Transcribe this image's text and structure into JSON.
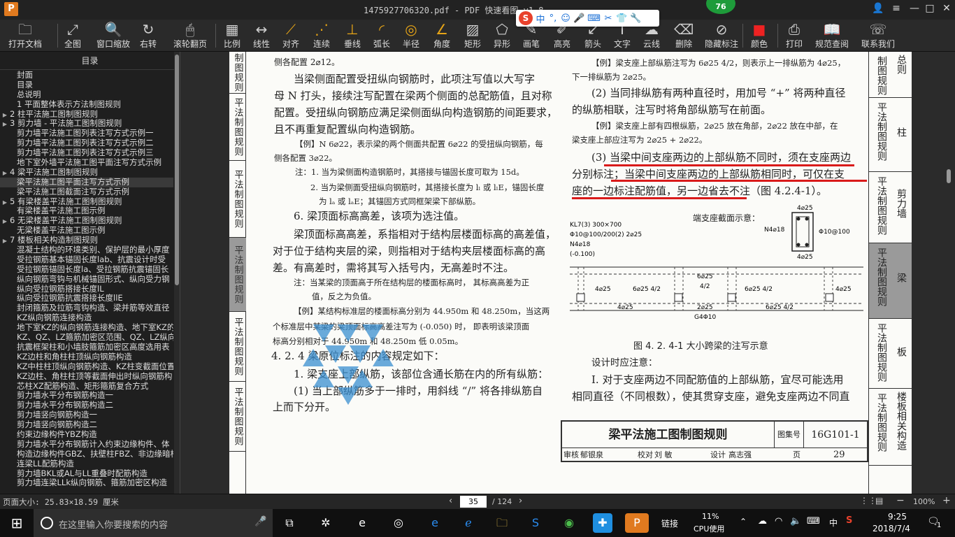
{
  "titlebar": {
    "title": "1475927706320.pdf - PDF 快速看图 v1.8",
    "app_icon": "P",
    "badge": "76"
  },
  "ime": {
    "logo": "S",
    "items": [
      "中",
      "°,",
      "☺",
      "🎤",
      "⌨",
      "✂",
      "👕",
      "🔧"
    ]
  },
  "toolbar": {
    "items": [
      {
        "label": "打开文档",
        "icon": "folder-icon",
        "glyph": "🗀"
      },
      {
        "label": "全图",
        "icon": "fullview-icon",
        "glyph": "⤢"
      },
      {
        "label": "窗口缩放",
        "icon": "zoom-window-icon",
        "glyph": "🔍"
      },
      {
        "label": "右转",
        "icon": "rotate-right-icon",
        "glyph": "↻"
      },
      {
        "label": "滚轮翻页",
        "icon": "mouse-wheel-icon",
        "glyph": "🖱"
      },
      {
        "label": "比例",
        "icon": "scale-icon",
        "glyph": "▦"
      },
      {
        "label": "线性",
        "icon": "linear-icon",
        "glyph": "↔"
      },
      {
        "label": "对齐",
        "icon": "align-icon",
        "glyph": "⟋"
      },
      {
        "label": "连续",
        "icon": "continuous-icon",
        "glyph": "⋰"
      },
      {
        "label": "垂线",
        "icon": "perpendicular-icon",
        "glyph": "⊥"
      },
      {
        "label": "弧长",
        "icon": "arc-length-icon",
        "glyph": "◜"
      },
      {
        "label": "半径",
        "icon": "radius-icon",
        "glyph": "◎"
      },
      {
        "label": "角度",
        "icon": "angle-icon",
        "glyph": "∠"
      },
      {
        "label": "矩形",
        "icon": "rectangle-icon",
        "glyph": "▨"
      },
      {
        "label": "异形",
        "icon": "irregular-icon",
        "glyph": "⬠"
      },
      {
        "label": "画笔",
        "icon": "brush-icon",
        "glyph": "✎"
      },
      {
        "label": "高亮",
        "icon": "highlight-icon",
        "glyph": "✐"
      },
      {
        "label": "箭头",
        "icon": "arrow-icon",
        "glyph": "↙"
      },
      {
        "label": "文字",
        "icon": "text-icon",
        "glyph": "T"
      },
      {
        "label": "云线",
        "icon": "cloud-icon",
        "glyph": "☁"
      },
      {
        "label": "删除",
        "icon": "eraser-icon",
        "glyph": "⌫"
      },
      {
        "label": "隐藏标注",
        "icon": "hide-annotation-icon",
        "glyph": "⊘"
      },
      {
        "label": "颜色",
        "icon": "color-icon",
        "glyph": "■"
      },
      {
        "label": "打印",
        "icon": "print-icon",
        "glyph": "⎙"
      },
      {
        "label": "规范查阅",
        "icon": "book-icon",
        "glyph": "📖"
      },
      {
        "label": "联系我们",
        "icon": "contact-icon",
        "glyph": "☏"
      }
    ]
  },
  "toc": {
    "title": "目录",
    "items": [
      {
        "text": "封面",
        "arrow": ""
      },
      {
        "text": "目录",
        "arrow": ""
      },
      {
        "text": "总说明",
        "arrow": ""
      },
      {
        "text": "1  平面整体表示方法制图规则",
        "arrow": ""
      },
      {
        "text": "2  柱平法施工图制图规则",
        "arrow": "▶"
      },
      {
        "text": "3  剪力墙 - 平法施工图制图规则",
        "arrow": "▶"
      },
      {
        "text": "剪力墙平法施工图列表注写方式示例一",
        "arrow": ""
      },
      {
        "text": "剪力墙平法施工图列表注写方式示例二",
        "arrow": ""
      },
      {
        "text": "剪力墙平法施工图列表注写方式示例三",
        "arrow": ""
      },
      {
        "text": "地下室外墙平法施工图平面注写方式示例",
        "arrow": ""
      },
      {
        "text": "4  梁平法施工图制图规则",
        "arrow": "▶"
      },
      {
        "text": "梁平法施工图平面注写方式示例",
        "arrow": ""
      },
      {
        "text": "梁平法施工图截面注写方式示例",
        "arrow": ""
      },
      {
        "text": "5  有梁楼盖平法施工图制图规则",
        "arrow": "▶"
      },
      {
        "text": "有梁楼盖平法施工图示例",
        "arrow": ""
      },
      {
        "text": "6  无梁楼盖平法施工图制图规则",
        "arrow": "▶"
      },
      {
        "text": "无梁楼盖平法施工图示例",
        "arrow": ""
      },
      {
        "text": "7  楼板相关构造制图规则",
        "arrow": "▶"
      },
      {
        "text": "混凝土结构的环境类别、保护层的最小厚度",
        "arrow": ""
      },
      {
        "text": "受拉钢筋基本锚固长度lab、抗震设计时受",
        "arrow": ""
      },
      {
        "text": "受拉钢筋锚固长度la、受拉钢筋抗震锚固长",
        "arrow": ""
      },
      {
        "text": "纵向钢筋弯钩与机械锚固形式、纵向受力钢",
        "arrow": ""
      },
      {
        "text": "纵向受拉钢筋搭接长度lL",
        "arrow": ""
      },
      {
        "text": "纵向受拉钢筋抗震搭接长度llE",
        "arrow": ""
      },
      {
        "text": "封闭箍筋及拉筋弯钩构造、梁并筋等效直径",
        "arrow": ""
      },
      {
        "text": "KZ纵向钢筋连接构造",
        "arrow": ""
      },
      {
        "text": "地下室KZ的纵向钢筋连接构造、地下室KZ的",
        "arrow": ""
      },
      {
        "text": "KZ、QZ、LZ箍筋加密区范围、QZ、LZ纵向钢",
        "arrow": ""
      },
      {
        "text": "抗震框架柱和小墙肢箍筋加密区高度选用表",
        "arrow": ""
      },
      {
        "text": "KZ边柱和角柱柱顶纵向钢筋构造",
        "arrow": ""
      },
      {
        "text": "KZ中柱柱顶纵向钢筋构造、KZ柱变截面位置",
        "arrow": ""
      },
      {
        "text": "KZ边柱、角柱柱顶等截面伸出时纵向钢筋构",
        "arrow": ""
      },
      {
        "text": "芯柱XZ配筋构造、矩形箍筋复合方式",
        "arrow": ""
      },
      {
        "text": "剪力墙水平分布钢筋构造一",
        "arrow": ""
      },
      {
        "text": "剪力墙水平分布钢筋构造二",
        "arrow": ""
      },
      {
        "text": "剪力墙竖向钢筋构造一",
        "arrow": ""
      },
      {
        "text": "剪力墙竖向钢筋构造二",
        "arrow": ""
      },
      {
        "text": "约束边缘构件YBZ构造",
        "arrow": ""
      },
      {
        "text": "剪力墙水平分布钢筋计入约束边缘构件、体",
        "arrow": ""
      },
      {
        "text": "构造边缘构件GBZ、扶壁柱FBZ、非边缘暗柱",
        "arrow": ""
      },
      {
        "text": "连梁LL配筋构造",
        "arrow": ""
      },
      {
        "text": "剪力墙BKL或AL与LL重叠时配筋构造",
        "arrow": ""
      },
      {
        "text": "剪力墙连梁LLk纵向钢筋、箍筋加密区构造",
        "arrow": ""
      }
    ],
    "selected_index": 11
  },
  "document": {
    "left_tabs": [
      "制图规则",
      "平法制图规则",
      "平法制图规则",
      "平法制图规则",
      "平法制图规则",
      "平法制图规则"
    ],
    "right_tabs": [
      {
        "a": "总则",
        "b": "制图规则"
      },
      {
        "a": "平法制图规则",
        "b": "柱"
      },
      {
        "a": "平法制图规则",
        "b": "剪力墙"
      },
      {
        "a": "平法制图规则",
        "b": "梁"
      },
      {
        "a": "平法制图规则",
        "b": "板"
      },
      {
        "a": "平法制图规则",
        "b": "楼板相关构造"
      }
    ],
    "left_col": {
      "l1": "侧各配置 2⌀12。",
      "l2": "当梁侧面配置受扭纵向钢筋时，此项注写值以大写字",
      "l3": "母 N 打头，接续注写配置在梁两个侧面的总配筋值，且对称",
      "l4": "配置。受扭纵向钢筋应满足梁侧面纵向构造钢筋的间距要求，",
      "l5": "且不再重复配置纵向构造钢筋。",
      "l6": "【例】N 6⌀22，表示梁的两个侧面共配置 6⌀22 的受扭纵向钢筋，每",
      "l7": "侧各配置 3⌀22。",
      "l8": "注：1. 当为梁侧面构造钢筋时，其搭接与锚固长度可取为 15d。",
      "l9": "2. 当为梁侧面受扭纵向钢筋时，其搭接长度为 lₗ 或 lₗE，锚固长度",
      "l10": "为 lₐ 或 lₐE；其锚固方式同框架梁下部纵筋。",
      "l11": "6. 梁顶面标高高差，该项为选注值。",
      "l12": "梁顶面标高高差，系指相对于结构层楼面标高的高差值，",
      "l13": "对于位于结构夹层的梁，则指相对于结构夹层楼面标高的高",
      "l14": "差。有高差时，需将其写入括号内，无高差时不注。",
      "l15": "注：当某梁的顶面高于所在结构层的楼面标高时，  其标高高差为正",
      "l16": "值，反之为负值。",
      "l17": "【例】某结构标准层的楼面标高分别为 44.950m 和 48.250m，当这两",
      "l18": "个标准层中某梁的梁顶面标高高差注写为 (-0.050) 时，  即表明该梁顶面",
      "l19": "标高分别相对于 44.950m 和 48.250m 低 0.05m。",
      "l20": "4. 2. 4  梁原位标注的内容规定如下：",
      "l21": "1. 梁支座上部纵筋，该部位含通长筋在内的所有纵筋：",
      "l22": "(1) 当上部纵筋多于一排时，用斜线 “/” 将各排纵筋自",
      "l23": "上而下分开。"
    },
    "right_col": {
      "r1": "【例】梁支座上部纵筋注写为 6⌀25 4/2，则表示上一排纵筋为 4⌀25，",
      "r2": "下一排纵筋为 2⌀25。",
      "r3": "(2) 当同排纵筋有两种直径时，用加号 “+” 将两种直径",
      "r4": "的纵筋相联，注写时将角部纵筋写在前面。",
      "r5": "【例】梁支座上部有四根纵筋，2⌀25 放在角部，2⌀22 放在中部，在",
      "r6": "梁支座上部应注写为 2⌀25 + 2⌀22。",
      "r7": "(3) 当梁中间支座两边的上部纵筋不同时，须在支座两边",
      "r8": "分别标注；当梁中间支座两边的上部纵筋相同时，可仅在支",
      "r9": "座的一边标注配筋值，另一边省去不注（图 4.2.4-1）。",
      "fig_caption": "图 4. 2. 4-1  大小跨梁的注写示意",
      "r10": "设计时应注意：",
      "r11": "Ⅰ. 对于支座两边不同配筋值的上部纵筋，宜尽可能选用",
      "r12": "相同直径（不同根数），使其贯穿支座，避免支座两边不同直"
    },
    "diagram": {
      "section_title": "端支座截面示意：",
      "kl": "KL7(3)  300×700",
      "stirrup": "Φ10@100/200(2)  2⌀25",
      "n": "N4⌀18",
      "elev": "(-0.100)",
      "sec_top": "4⌀25",
      "sec_n": "N4⌀18",
      "sec_phi": "Φ10@100",
      "sec_bot": "4⌀25",
      "top_a": "4⌀25",
      "top_b": "6⌀25  4/2",
      "top_c": "6⌀25",
      "top_c2": "4/2",
      "top_d": "6⌀25  4/2",
      "top_e": "4⌀25",
      "bot_a": "4⌀25",
      "bot_b": "2⌀25",
      "bot_b2": "G4Φ10",
      "bot_c": "6⌀25  4/2"
    },
    "titleblock": {
      "title": "梁平法施工图制图规则",
      "label_atlas": "图集号",
      "code": "16G101-1",
      "review": "审核",
      "reviewer": "郁银泉",
      "check": "校对",
      "checker": "刘  敏",
      "design": "设计",
      "designer": "高志强",
      "page_label": "页",
      "page": "29"
    }
  },
  "statusbar": {
    "page_size": "页面大小: 25.83×18.59 厘米",
    "current_page": "35",
    "total": "/ 124",
    "zoom": "100%"
  },
  "taskbar": {
    "search_placeholder": "在这里输入你要搜索的内容",
    "link_label": "链接",
    "cpu": "11%",
    "cpu_label": "CPU使用",
    "ime_lang": "中",
    "time": "9:25",
    "date": "2018/7/4",
    "notif_count": "1"
  },
  "colors": {
    "accent": "#e07a1f",
    "annotation_red": "#d91a1a",
    "toolbar_bg": "#2a2a2a"
  }
}
